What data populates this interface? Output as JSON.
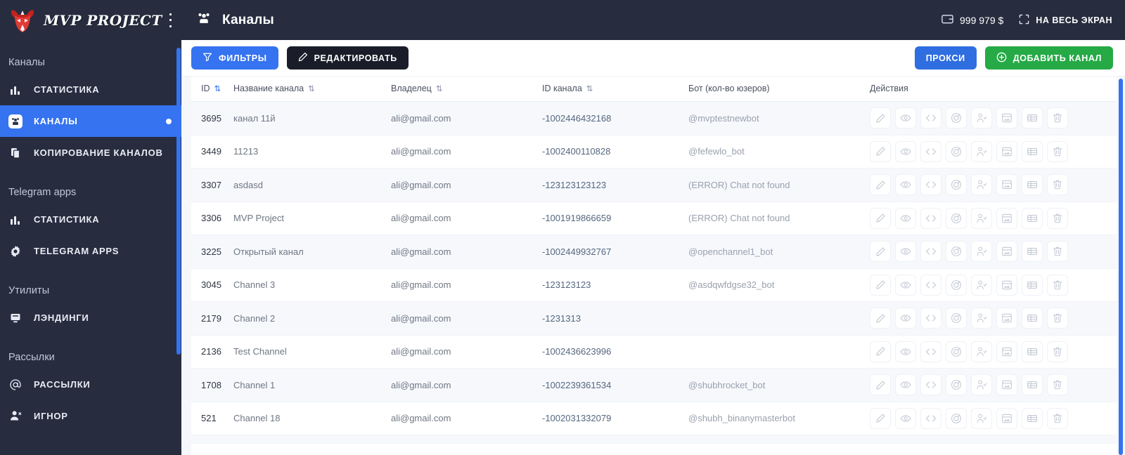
{
  "brand": {
    "title": "MVP PROJECT",
    "logo_icon": "bull-head-logo",
    "menu_icon": "hamburger-menu-icon"
  },
  "sidebar": {
    "groups": [
      {
        "label": "Каналы",
        "items": [
          {
            "label": "СТАТИСТИКА",
            "icon": "bar-chart-icon",
            "active": false,
            "dot": false
          },
          {
            "label": "КАНАЛЫ",
            "icon": "channels-group-icon",
            "active": true,
            "dot": true
          },
          {
            "label": "КОПИРОВАНИЕ КАНАЛОВ",
            "icon": "copy-icon",
            "active": false,
            "dot": false
          }
        ]
      },
      {
        "label": "Telegram apps",
        "items": [
          {
            "label": "СТАТИСТИКА",
            "icon": "bar-chart-icon",
            "active": false,
            "dot": false
          },
          {
            "label": "TELEGRAM APPS",
            "icon": "gear-icon",
            "active": false,
            "dot": false
          }
        ]
      },
      {
        "label": "Утилиты",
        "items": [
          {
            "label": "ЛЭНДИНГИ",
            "icon": "landing-page-icon",
            "active": false,
            "dot": false
          }
        ]
      },
      {
        "label": "Рассылки",
        "items": [
          {
            "label": "РАССЫЛКИ",
            "icon": "at-sign-icon",
            "active": false,
            "dot": false
          },
          {
            "label": "ИГНОР",
            "icon": "user-remove-icon",
            "active": false,
            "dot": false
          }
        ]
      }
    ]
  },
  "topbar": {
    "page_icon": "channels-group-icon",
    "title": "Каналы",
    "balance": "999 979 $",
    "balance_icon": "wallet-icon",
    "fullscreen_label": "НА ВЕСЬ ЭКРАН",
    "fullscreen_icon": "expand-icon"
  },
  "toolbar": {
    "filters_label": "ФИЛЬТРЫ",
    "filters_icon": "funnel-icon",
    "edit_label": "РЕДАКТИРОВАТЬ",
    "edit_icon": "pencil-icon",
    "proxy_label": "ПРОКСИ",
    "add_channel_label": "ДОБАВИТЬ КАНАЛ",
    "add_channel_icon": "plus-circle-icon"
  },
  "table": {
    "columns": [
      {
        "label": "ID",
        "sortable": true,
        "sort_active": true
      },
      {
        "label": "Название канала",
        "sortable": true,
        "sort_active": false
      },
      {
        "label": "Владелец",
        "sortable": true,
        "sort_active": false
      },
      {
        "label": "ID канала",
        "sortable": true,
        "sort_active": false
      },
      {
        "label": "Бот (кол-во юзеров)",
        "sortable": false,
        "sort_active": false
      },
      {
        "label": "Действия",
        "sortable": false,
        "sort_active": false
      }
    ],
    "action_icons": [
      "pencil-icon",
      "eye-icon",
      "code-brackets-icon",
      "speedometer-icon",
      "user-check-icon",
      "image-card-icon",
      "table-rows-icon",
      "trash-icon"
    ],
    "rows": [
      {
        "id": "3695",
        "name": "канал 11й",
        "owner": "ali@gmail.com",
        "channel_id": "-1002446432168",
        "bot": "@mvptestnewbot"
      },
      {
        "id": "3449",
        "name": "11213",
        "owner": "ali@gmail.com",
        "channel_id": "-1002400110828",
        "bot": "@fefewlo_bot"
      },
      {
        "id": "3307",
        "name": "asdasd",
        "owner": "ali@gmail.com",
        "channel_id": "-123123123123",
        "bot": "(ERROR) Chat not found"
      },
      {
        "id": "3306",
        "name": "MVP Project",
        "owner": "ali@gmail.com",
        "channel_id": "-1001919866659",
        "bot": "(ERROR) Chat not found"
      },
      {
        "id": "3225",
        "name": "Открытый канал",
        "owner": "ali@gmail.com",
        "channel_id": "-1002449932767",
        "bot": "@openchannel1_bot"
      },
      {
        "id": "3045",
        "name": "Channel 3",
        "owner": "ali@gmail.com",
        "channel_id": "-123123123",
        "bot": "@asdqwfdgse32_bot"
      },
      {
        "id": "2179",
        "name": "Channel 2",
        "owner": "ali@gmail.com",
        "channel_id": "-1231313",
        "bot": ""
      },
      {
        "id": "2136",
        "name": "Test Channel",
        "owner": "ali@gmail.com",
        "channel_id": "-1002436623996",
        "bot": ""
      },
      {
        "id": "1708",
        "name": "Channel 1",
        "owner": "ali@gmail.com",
        "channel_id": "-1002239361534",
        "bot": "@shubhrocket_bot"
      },
      {
        "id": "521",
        "name": "Channel 18",
        "owner": "ali@gmail.com",
        "channel_id": "-1002031332079",
        "bot": "@shubh_binanymasterbot"
      }
    ]
  },
  "colors": {
    "sidebar_bg": "#272d3f",
    "accent_blue": "#3573f0",
    "green": "#25aa46",
    "dark_button": "#1a1d29",
    "row_stripe": "#f6f8fc",
    "link_blue": "#55677f"
  }
}
